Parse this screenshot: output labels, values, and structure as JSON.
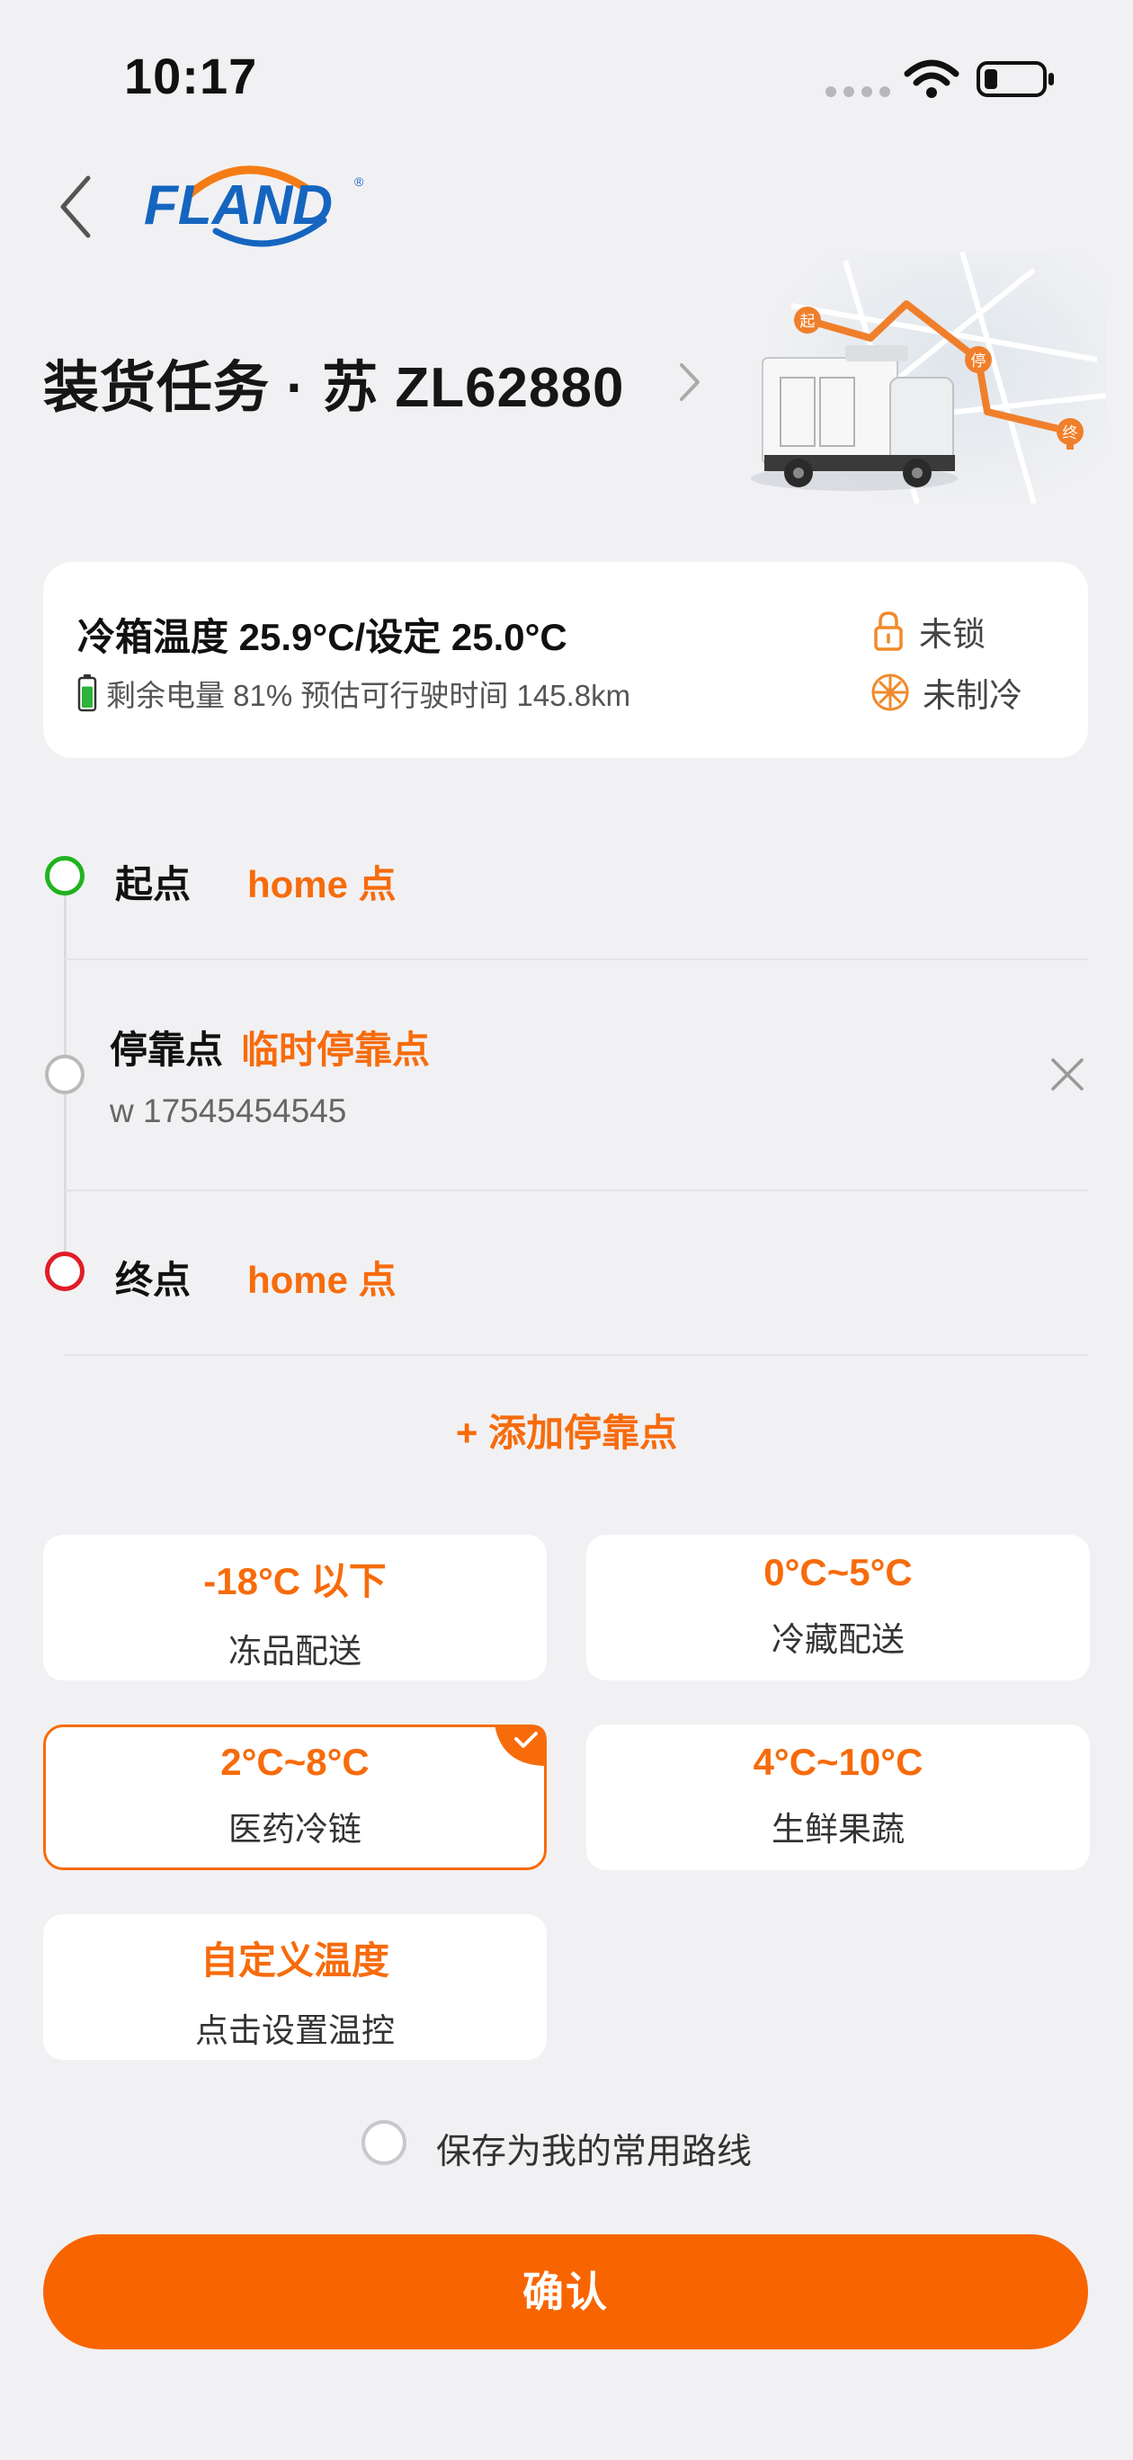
{
  "status_bar": {
    "time": "10:17"
  },
  "header": {
    "logo_text": "FLAND",
    "title": "装货任务 · 苏 ZL62880"
  },
  "hero": {
    "map_labels": [
      "起",
      "停",
      "终"
    ]
  },
  "info_card": {
    "temperature": "冷箱温度 25.9°C/设定 25.0°C",
    "battery": "剩余电量 81% 预估可行驶时间 145.8km",
    "lock_status": "未锁",
    "cooling_status": "未制冷",
    "battery_level": 0.81
  },
  "route": {
    "start": {
      "label": "起点",
      "value": "home 点"
    },
    "stop": {
      "label": "停靠点",
      "value": "临时停靠点",
      "detail": "w 17545454545"
    },
    "end": {
      "label": "终点",
      "value": "home 点"
    },
    "add_stop": "+ 添加停靠点"
  },
  "temp_options": [
    {
      "value": "-18°C 以下",
      "label": "冻品配送",
      "selected": false
    },
    {
      "value": "0°C~5°C",
      "label": "冷藏配送",
      "selected": false
    },
    {
      "value": "2°C~8°C",
      "label": "医药冷链",
      "selected": true
    },
    {
      "value": "4°C~10°C",
      "label": "生鲜果蔬",
      "selected": false
    },
    {
      "value": "自定义温度",
      "label": "点击设置温控",
      "selected": false
    }
  ],
  "save_route": {
    "label": "保存为我的常用路线",
    "checked": false
  },
  "confirm": {
    "label": "确认"
  },
  "colors": {
    "accent": "#f76b0b",
    "start": "#1fb31f",
    "end": "#e01d27",
    "background": "#f1f1f3"
  }
}
